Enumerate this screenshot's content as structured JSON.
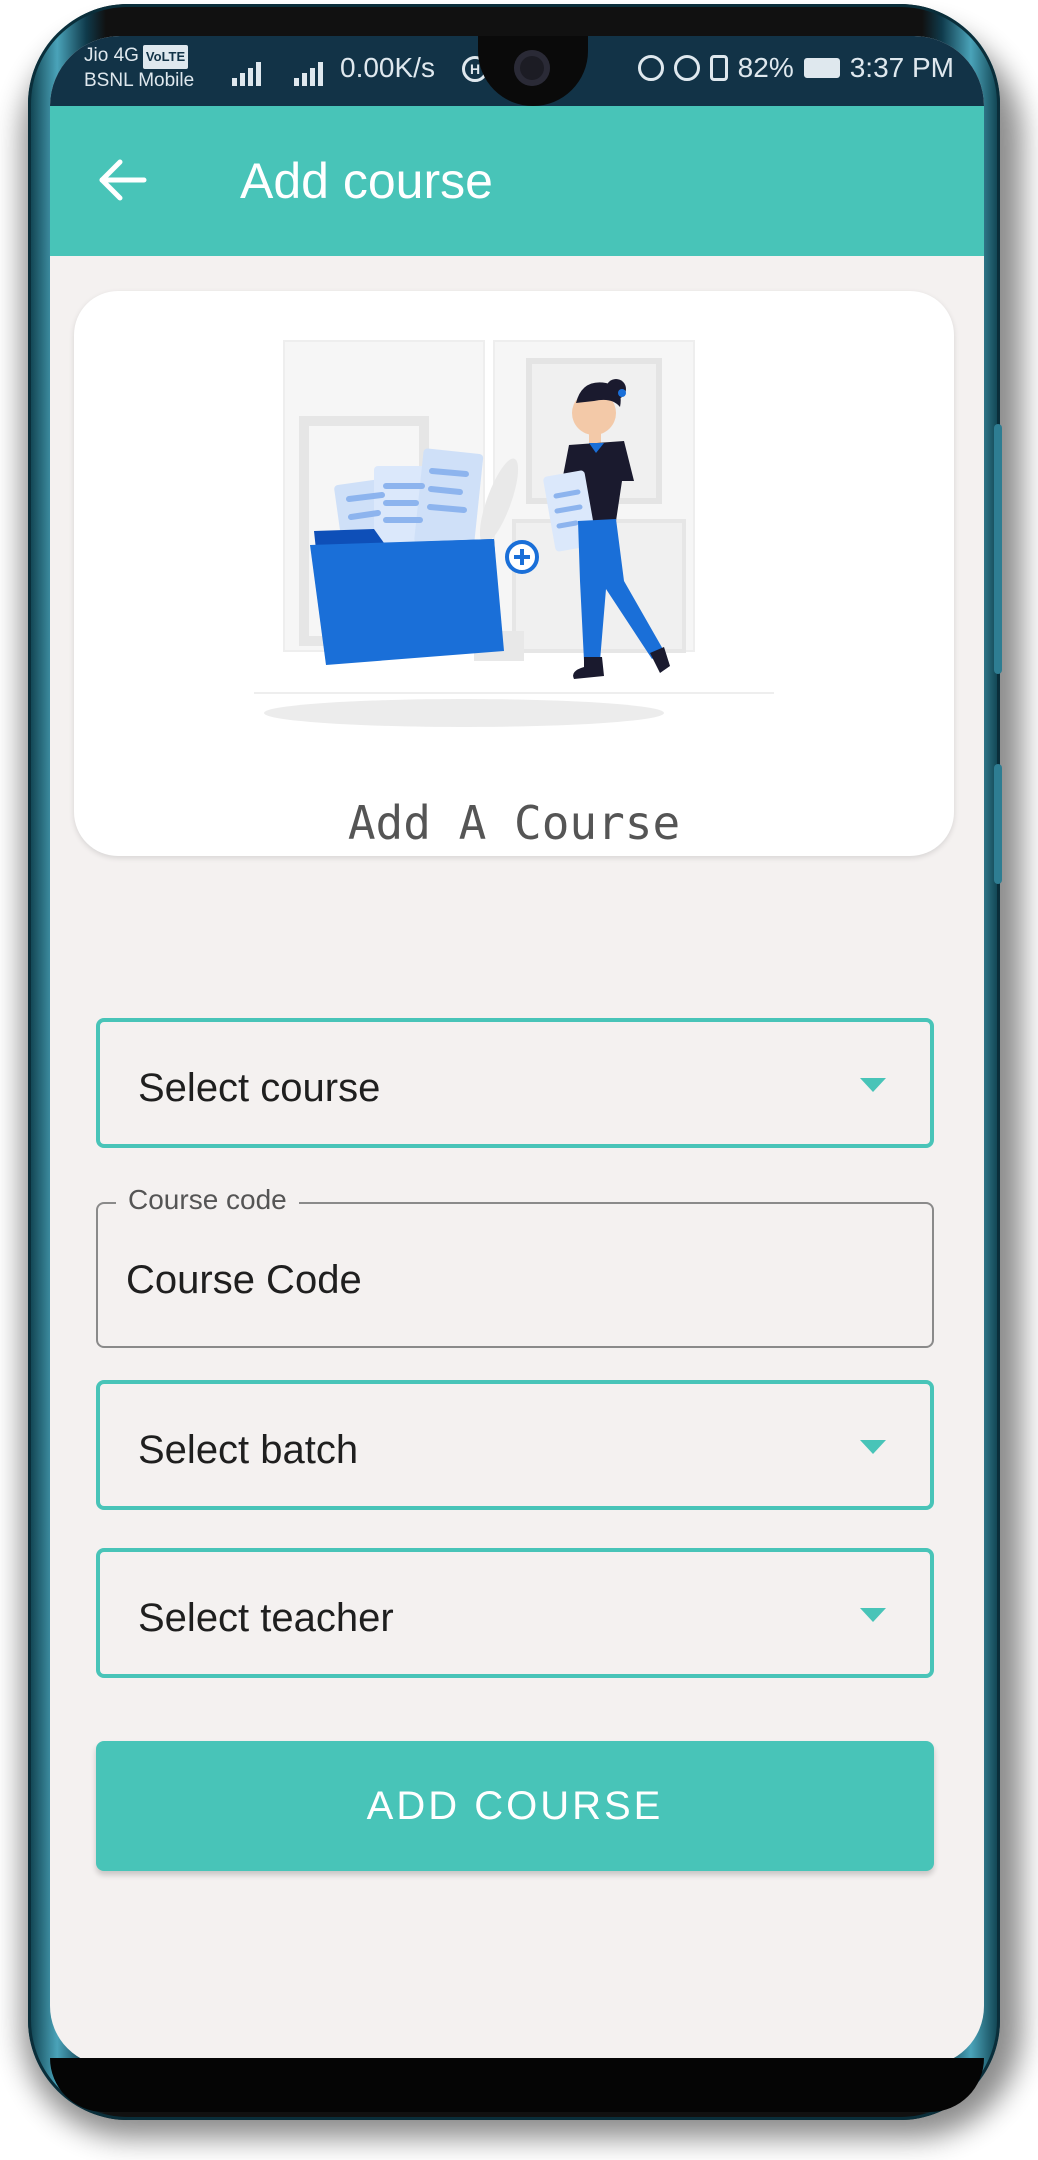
{
  "status_bar": {
    "carrier_line1": "Jio 4G",
    "volte_badge": "VoLTE",
    "carrier_line2": "BSNL Mobile",
    "network_type": "4G",
    "data_speed": "0.00K/s",
    "battery_percent": "82%",
    "time": "3:37 PM"
  },
  "app_bar": {
    "title": "Add course",
    "back_icon": "arrow-left-icon"
  },
  "header_card": {
    "caption": "Add A Course",
    "illustration": "woman-adding-documents-to-folder"
  },
  "form": {
    "course_dropdown": {
      "value": "Select course"
    },
    "course_code": {
      "label": "Course code",
      "value": "Course Code"
    },
    "batch_dropdown": {
      "value": "Select batch"
    },
    "teacher_dropdown": {
      "value": "Select teacher"
    },
    "submit_label": "ADD COURSE"
  },
  "colors": {
    "accent": "#48c4b8",
    "status_bar": "#123347",
    "background": "#f4f1f0",
    "illustration_blue": "#1a6fd8"
  }
}
